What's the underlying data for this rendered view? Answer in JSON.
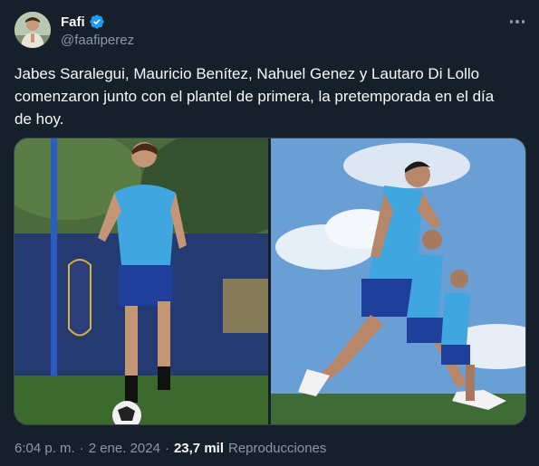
{
  "author": {
    "display_name": "Fafi",
    "handle": "@faafiperez",
    "verified": true
  },
  "tweet": {
    "text": "Jabes Saralegui, Mauricio Benítez, Nahuel Genez y Lautaro Di Lollo\ncomenzaron junto con el plantel de primera, la pretemporada en el día\nde hoy."
  },
  "meta": {
    "time": "6:04 p. m.",
    "separator": "·",
    "date": "2 ene. 2024",
    "views_count": "23,7 mil",
    "views_label": "Reproducciones"
  },
  "icons": {
    "verified": "verified-badge-icon",
    "more": "more-options-icon"
  },
  "colors": {
    "background": "#15202b",
    "accent": "#1d9bf0",
    "muted": "#8b98a5"
  }
}
